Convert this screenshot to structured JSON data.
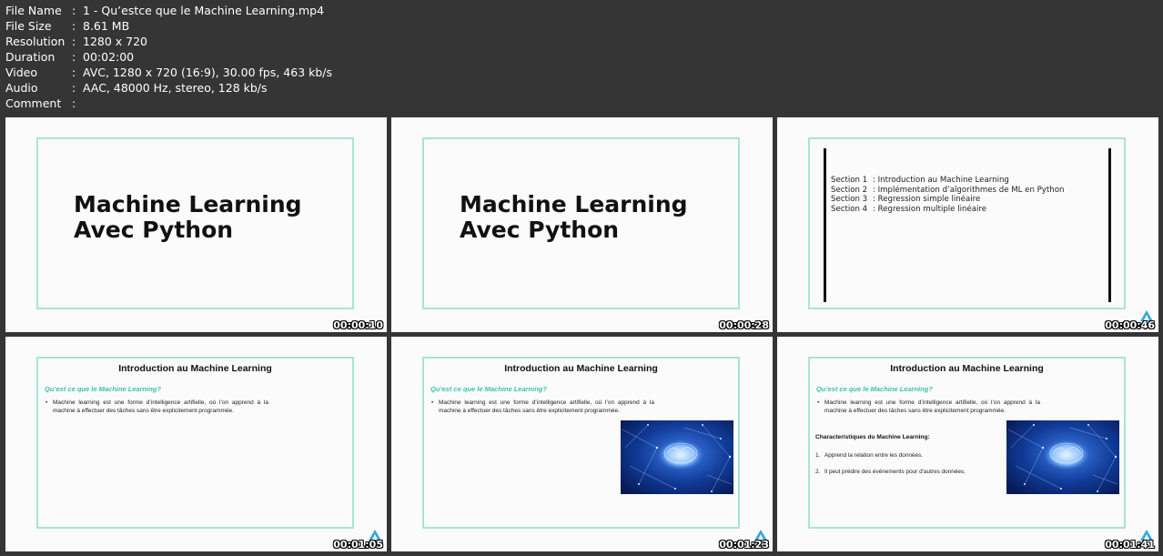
{
  "meta": {
    "rows": [
      {
        "key": "File Name",
        "sep": ":",
        "value": "1 - Qu’estce que le Machine Learning.mp4"
      },
      {
        "key": "File Size",
        "sep": ":",
        "value": "8.61 MB"
      },
      {
        "key": "Resolution",
        "sep": ":",
        "value": "1280 x 720"
      },
      {
        "key": "Duration",
        "sep": ":",
        "value": "00:02:00"
      },
      {
        "key": "Video",
        "sep": ":",
        "value": "AVC, 1280 x 720 (16:9), 30.00 fps, 463 kb/s"
      },
      {
        "key": "Audio",
        "sep": ":",
        "value": "AAC, 48000 Hz, stereo, 128 kb/s"
      },
      {
        "key": "Comment",
        "sep": ":",
        "value": ""
      }
    ]
  },
  "thumbs": [
    {
      "timestamp": "00:00:10",
      "title_line1": "Machine Learning",
      "title_line2": "Avec Python"
    },
    {
      "timestamp": "00:00:28",
      "title_line1": "Machine Learning",
      "title_line2": "Avec Python"
    },
    {
      "timestamp": "00:00:46",
      "sections": [
        {
          "num": "Section 1",
          "label": ": Introduction au Machine Learning"
        },
        {
          "num": "Section 2",
          "label": ": Implémentation d’algorithmes de ML en Python"
        },
        {
          "num": "Section 3",
          "label": ": Regression simple linéaire"
        },
        {
          "num": "Section 4",
          "label": ": Regression multiple linéaire"
        }
      ]
    },
    {
      "timestamp": "00:01:05",
      "heading": "Introduction au Machine Learning",
      "subtitle": "Qu’est ce que le Machine Learning?",
      "bullet": "Machine learning est une forme d’intelligence artifielle, où l’on apprend à la machine à effectuer des tâches sans être explicitement programmée."
    },
    {
      "timestamp": "00:01:23",
      "heading": "Introduction au Machine Learning",
      "subtitle": "Qu’est ce que le Machine Learning?",
      "bullet": "Machine learning est une forme d’intelligence artifielle, où l’on apprend à la machine à effectuer des tâches sans être explicitement programmée."
    },
    {
      "timestamp": "00:01:41",
      "heading": "Introduction au Machine Learning",
      "subtitle": "Qu’est ce que le Machine Learning?",
      "bullet": "Machine learning est une forme d’intelligence artifielle, où l’on apprend à la machine à effectuer des tâches sans être explicitement programmée.",
      "char_title": "Characteristiques du Machine Learning:",
      "char_items": [
        {
          "num": "1.",
          "text": "Apprend la relation entre les données."
        },
        {
          "num": "2.",
          "text": "Il peut prédire des événements pour d’autres données."
        }
      ]
    }
  ],
  "colors": {
    "background": "#353535",
    "slide_bg": "#fbfbfb",
    "frame": "#a8e4d8",
    "subtitle": "#3fbfae",
    "logo": "#3aa6d8"
  }
}
